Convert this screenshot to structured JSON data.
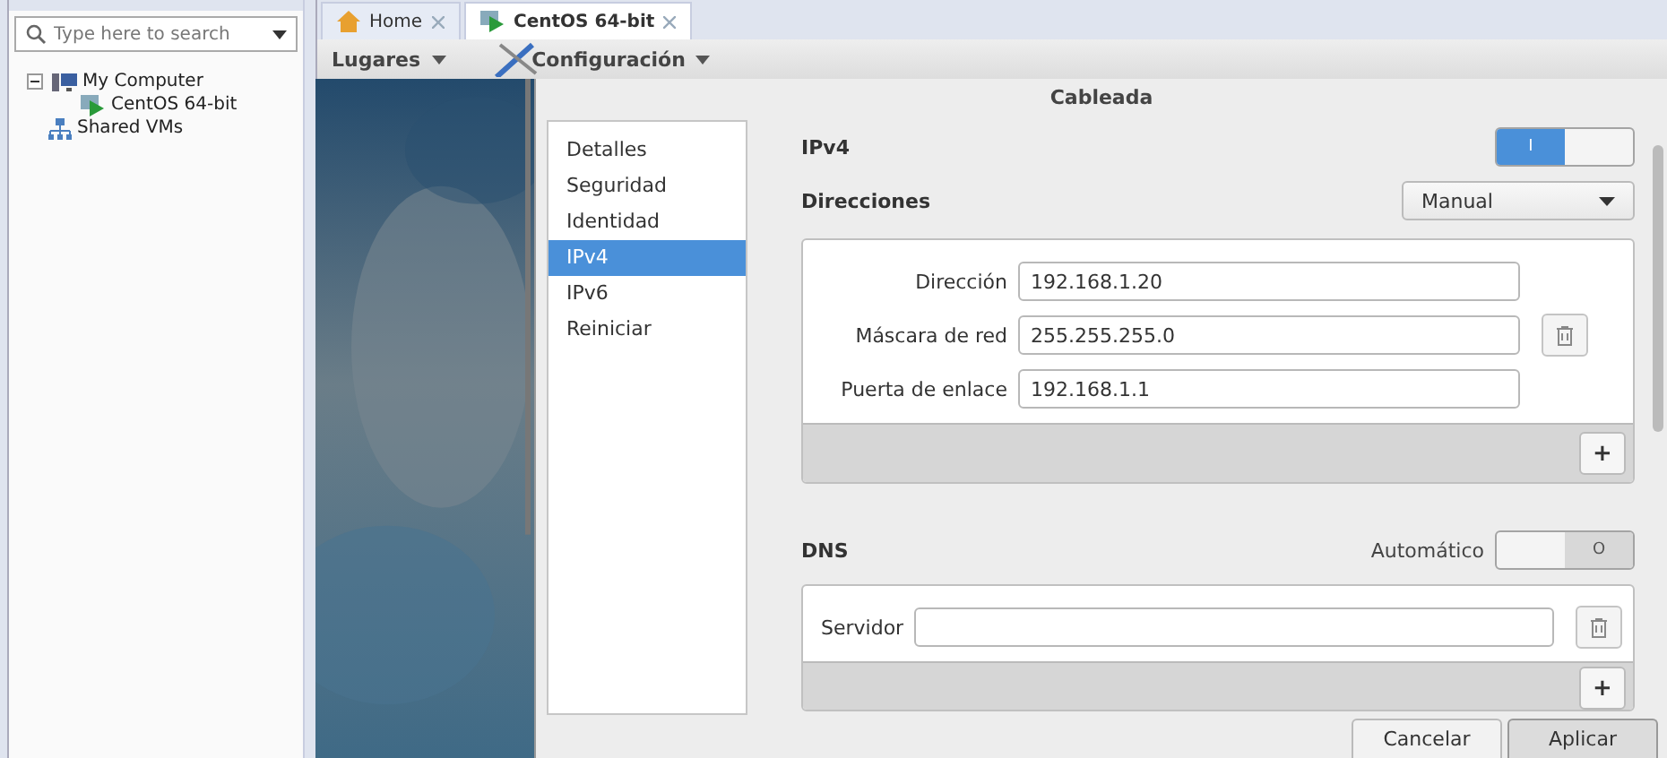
{
  "library": {
    "search": {
      "placeholder": "Type here to search"
    },
    "tree": [
      {
        "label": "My Computer",
        "kind": "computer",
        "expanded": true,
        "children": [
          {
            "label": "CentOS 64-bit",
            "kind": "vm"
          }
        ]
      },
      {
        "label": "Shared VMs",
        "kind": "shared"
      }
    ]
  },
  "tabs": [
    {
      "label": "Home",
      "kind": "home",
      "selected": false
    },
    {
      "label": "CentOS 64-bit",
      "kind": "vm",
      "selected": true
    }
  ],
  "menus": [
    "Lugares",
    "Configuración"
  ],
  "dialog": {
    "title": "Cableada",
    "nav": [
      {
        "label": "Detalles",
        "selected": false
      },
      {
        "label": "Seguridad",
        "selected": false
      },
      {
        "label": "Identidad",
        "selected": false
      },
      {
        "label": "IPv4",
        "selected": true
      },
      {
        "label": "IPv6",
        "selected": false
      },
      {
        "label": "Reiniciar",
        "selected": false
      }
    ],
    "ipv4": {
      "heading": "IPv4",
      "toggle": {
        "on": true,
        "label": "I"
      }
    },
    "addresses": {
      "label": "Direcciones",
      "method": "Manual",
      "add": "+",
      "fields": [
        {
          "label": "Dirección",
          "value": "192.168.1.20",
          "removable": false
        },
        {
          "label": "Máscara de red",
          "value": "255.255.255.0",
          "removable": true
        },
        {
          "label": "Puerta de enlace",
          "value": "192.168.1.1",
          "removable": false
        }
      ]
    },
    "dns": {
      "heading": "DNS",
      "auto_label": "Automático",
      "toggle": {
        "on": false,
        "label": "O"
      },
      "add": "+",
      "servers": [
        {
          "label": "Servidor",
          "removable": true
        }
      ]
    },
    "buttons": [
      {
        "label": "Cancelar",
        "kind": "default"
      },
      {
        "label": "Aplicar",
        "kind": "pressed"
      }
    ]
  }
}
